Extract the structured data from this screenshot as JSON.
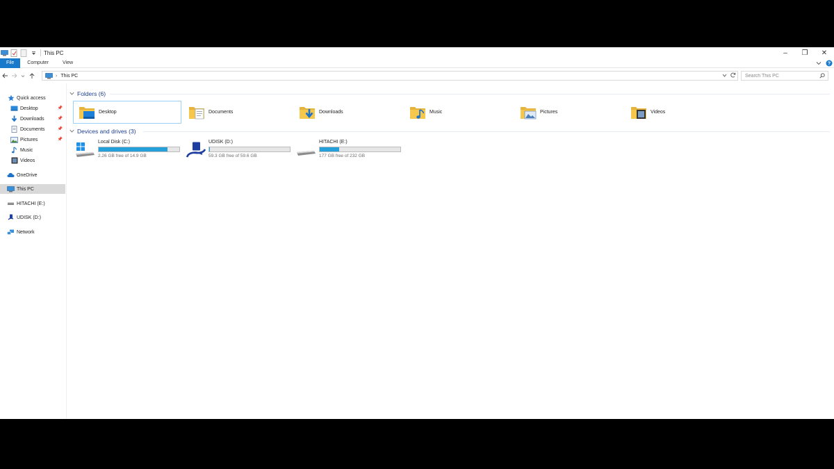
{
  "window": {
    "title": "This PC",
    "minimize": "–",
    "restore": "❐",
    "close": "✕"
  },
  "ribbon": {
    "tabs": [
      "File",
      "Computer",
      "View"
    ],
    "expand": "⌄",
    "help": "?"
  },
  "address": {
    "path": "This PC",
    "search_placeholder": "Search This PC"
  },
  "sidebar": {
    "quick_access": "Quick access",
    "items": [
      {
        "label": "Desktop",
        "pinned": true
      },
      {
        "label": "Downloads",
        "pinned": true
      },
      {
        "label": "Documents",
        "pinned": true
      },
      {
        "label": "Pictures",
        "pinned": true
      },
      {
        "label": "Music",
        "pinned": false
      },
      {
        "label": "Videos",
        "pinned": false
      }
    ],
    "onedrive": "OneDrive",
    "this_pc": "This PC",
    "hitachi": "HITACHI (E:)",
    "udisk": "UDISK (D:)",
    "network": "Network"
  },
  "folders": {
    "header": "Folders (6)",
    "items": [
      "Desktop",
      "Documents",
      "Downloads",
      "Music",
      "Pictures",
      "Videos"
    ]
  },
  "drives": {
    "header": "Devices and drives (3)",
    "items": [
      {
        "name": "Local Disk (C:)",
        "free": "2.26 GB free of 14.9 GB",
        "used_fraction": 0.85
      },
      {
        "name": "UDISK (D:)",
        "free": "59.3 GB free of 59.6 GB",
        "used_fraction": 0.005
      },
      {
        "name": "HITACHI (E:)",
        "free": "177 GB free of 232 GB",
        "used_fraction": 0.24
      }
    ]
  },
  "colors": {
    "accent": "#1979ca",
    "drive_bar": "#26a0da",
    "folder_yellow": "#f5c74d",
    "group_header": "#1e3f8f"
  }
}
